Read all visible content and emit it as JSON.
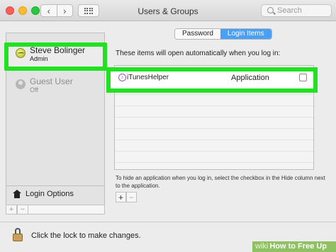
{
  "window": {
    "title": "Users & Groups",
    "search_placeholder": "Search"
  },
  "users": [
    {
      "name": "Steve Bolinger",
      "role": "Admin"
    },
    {
      "name": "Guest User",
      "role": "Off"
    }
  ],
  "sidebar": {
    "login_options": "Login Options",
    "add": "+",
    "remove": "−"
  },
  "tabs": [
    {
      "label": "Password",
      "active": false
    },
    {
      "label": "Login Items",
      "active": true
    }
  ],
  "main": {
    "info": "These items will open automatically when you log in:",
    "items": [
      {
        "name": "iTunesHelper",
        "kind": "Application",
        "hide": false
      }
    ],
    "hint": "To hide an application when you log in, select the checkbox in the Hide column next to the application.",
    "add": "+",
    "remove": "−"
  },
  "footer": {
    "lock_text": "Click the lock to make changes."
  },
  "watermark": {
    "brand": "wiki",
    "text": "How to Free Up RAM"
  },
  "colors": {
    "highlight": "#22e022",
    "accent": "#4aa0f7"
  }
}
